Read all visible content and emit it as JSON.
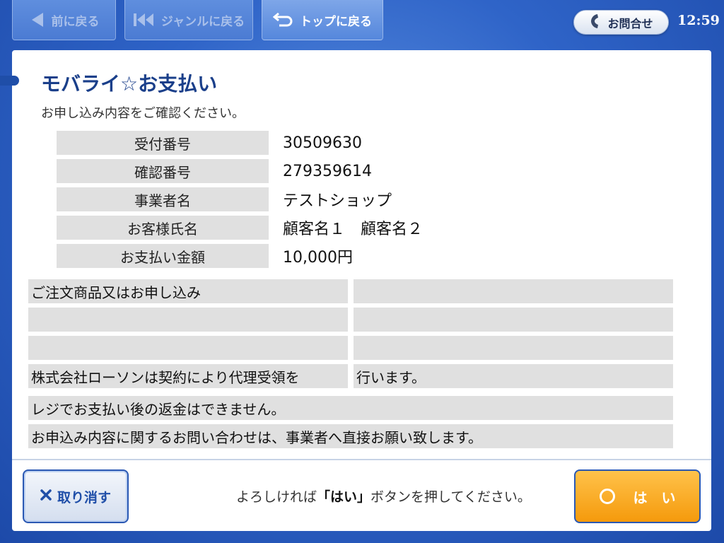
{
  "nav": {
    "back_label": "前に戻る",
    "genre_label": "ジャンルに戻る",
    "top_label": "トップに戻る",
    "contact_label": "お問合せ",
    "time": "12:59"
  },
  "page": {
    "title": "モバライ☆お支払い",
    "subtitle": "お申し込み内容をご確認ください。"
  },
  "details": [
    {
      "label": "受付番号",
      "value": "30509630"
    },
    {
      "label": "確認番号",
      "value": "279359614"
    },
    {
      "label": "事業者名",
      "value": "テストショップ"
    },
    {
      "label": "お客様氏名",
      "value": "顧客名１　顧客名２"
    },
    {
      "label": "お支払い金額",
      "value": "10,000円"
    }
  ],
  "order": {
    "rows": [
      {
        "left": "ご注文商品又はお申し込み",
        "right": ""
      },
      {
        "left": "",
        "right": ""
      },
      {
        "left": "",
        "right": ""
      },
      {
        "left": "株式会社ローソンは契約により代理受領を",
        "right": "行います。"
      }
    ],
    "notices": [
      "レジでお支払い後の返金はできません。",
      "お申込み内容に関するお問い合わせは、事業者へ直接お願い致します。"
    ]
  },
  "footer": {
    "cancel_label": "取り消す",
    "message_prefix": "よろしければ",
    "message_key": "「はい」",
    "message_suffix": "ボタンを押してください。",
    "yes_label": "は　い"
  },
  "colors": {
    "accent": "#1f4ea8",
    "yes_button": "#f59a0c",
    "cell_gray": "#e0e0e0"
  }
}
